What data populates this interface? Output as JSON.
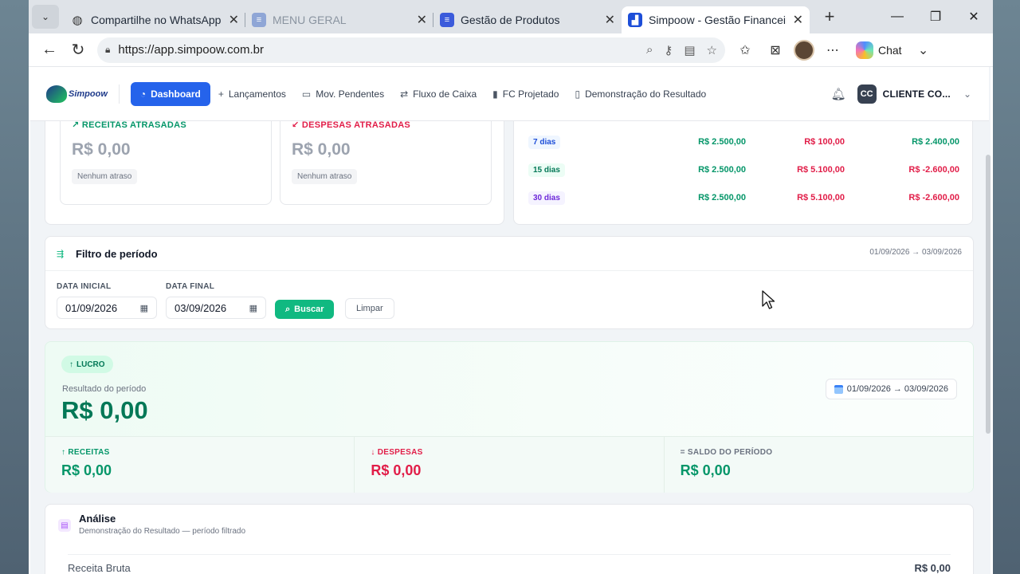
{
  "browser": {
    "tabs": [
      {
        "title": "Compartilhe no WhatsApp",
        "icon": "globe-icon",
        "active": false
      },
      {
        "title": "MENU GERAL",
        "icon": "doc-icon",
        "active": false
      },
      {
        "title": "Gestão de Produtos",
        "icon": "doc-icon",
        "active": false
      },
      {
        "title": "Simpoow - Gestão Financeira In",
        "icon": "chart-favicon-icon",
        "active": true
      }
    ],
    "url": "https://app.simpoow.com.br",
    "chat_label": "Chat"
  },
  "app": {
    "logo_text": "Simpoow",
    "nav": [
      {
        "label": "Dashboard",
        "icon": "dashboard-icon",
        "active": true
      },
      {
        "label": "Lançamentos",
        "icon": "plus-icon"
      },
      {
        "label": "Mov. Pendentes",
        "icon": "calendar-icon"
      },
      {
        "label": "Fluxo de Caixa",
        "icon": "transfer-icon"
      },
      {
        "label": "FC Projetado",
        "icon": "bar-chart-icon"
      },
      {
        "label": "Demonstração do Resultado",
        "icon": "document-icon"
      }
    ],
    "client_initials": "CC",
    "client_name": "CLIENTE CO..."
  },
  "overdue": {
    "receitas": {
      "label": "RECEITAS ATRASADAS",
      "value": "R$ 0,00",
      "badge": "Nenhum atraso",
      "color": "#059669"
    },
    "despesas": {
      "label": "DESPESAS ATRASADAS",
      "value": "R$ 0,00",
      "badge": "Nenhum atraso",
      "color": "#e11d48"
    }
  },
  "projection": [
    {
      "period": "7 dias",
      "receitas": "R$ 2.500,00",
      "despesas": "R$ 100,00",
      "saldo": "R$ 2.400,00",
      "saldo_positive": true
    },
    {
      "period": "15 dias",
      "receitas": "R$ 2.500,00",
      "despesas": "R$ 5.100,00",
      "saldo": "R$ -2.600,00",
      "saldo_positive": false
    },
    {
      "period": "30 dias",
      "receitas": "R$ 2.500,00",
      "despesas": "R$ 5.100,00",
      "saldo": "R$ -2.600,00",
      "saldo_positive": false
    }
  ],
  "filter": {
    "title": "Filtro de período",
    "range": "01/09/2026 → 03/09/2026",
    "start_label": "DATA INICIAL",
    "start_value": "01/09/2026",
    "end_label": "DATA FINAL",
    "end_value": "03/09/2026",
    "search_label": "Buscar",
    "clear_label": "Limpar"
  },
  "result": {
    "badge": "LUCRO",
    "label": "Resultado do período",
    "value": "R$ 0,00",
    "range": "01/09/2026 → 03/09/2026",
    "receitas_label": "RECEITAS",
    "receitas_value": "R$ 0,00",
    "despesas_label": "DESPESAS",
    "despesas_value": "R$ 0,00",
    "saldo_label": "= SALDO DO PERÍODO",
    "saldo_value": "R$ 0,00"
  },
  "analysis": {
    "title": "Análise",
    "subtitle": "Demonstração do Resultado — período filtrado",
    "rows": [
      {
        "label": "Receita Bruta",
        "value": "R$ 0,00"
      }
    ]
  },
  "colors": {
    "accent": "#2563eb",
    "success": "#10b981",
    "positive": "#059669",
    "negative": "#e11d48"
  }
}
